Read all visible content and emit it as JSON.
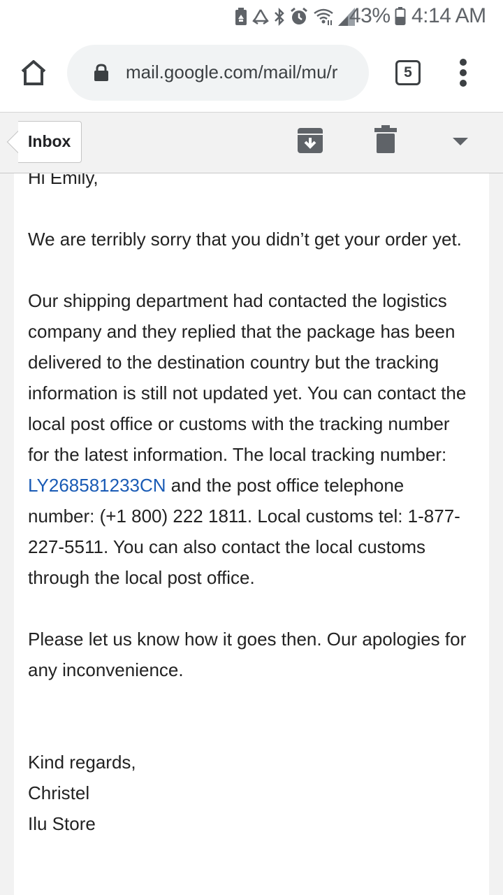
{
  "status_bar": {
    "battery_percent": "43%",
    "time": "4:14 AM",
    "icons": [
      "recycle-icon",
      "recycle-alt-icon",
      "bluetooth-icon",
      "alarm-icon",
      "wifi-icon",
      "signal-icon",
      "battery-icon"
    ]
  },
  "browser": {
    "url": "mail.google.com/mail/mu/r",
    "tab_count": "5",
    "icons": [
      "home-icon",
      "lock-icon",
      "tabs-icon",
      "overflow-menu-icon"
    ]
  },
  "action_bar": {
    "back_label": "Inbox",
    "icons": [
      "archive-icon",
      "trash-icon",
      "dropdown-arrow-icon"
    ]
  },
  "email": {
    "greeting": "Hi Emily,",
    "para1": "We are terribly sorry that you didn’t get your order yet.",
    "para2_before_link": "Our shipping department had contacted the logistics company and they replied that the package has been delivered to the destination country but the tracking information is still not updated yet. You can contact the local post office or customs with the tracking number for the latest information. The local tracking number: ",
    "tracking_number": "LY268581233CN",
    "para2_after_link": " and the post office telephone number: (+1 800) 222 1811. Local customs tel: 1-877-227-5511. You can also contact the local customs through the local post office.",
    "para3": "Please let us know how it goes then. Our apologies for any inconvenience.",
    "closing": "Kind regards,",
    "signature_name": "Christel",
    "signature_store": "Ilu Store"
  },
  "colors": {
    "link": "#1a5bb5",
    "status_text": "#5f6368",
    "background": "#f2f2f2"
  }
}
